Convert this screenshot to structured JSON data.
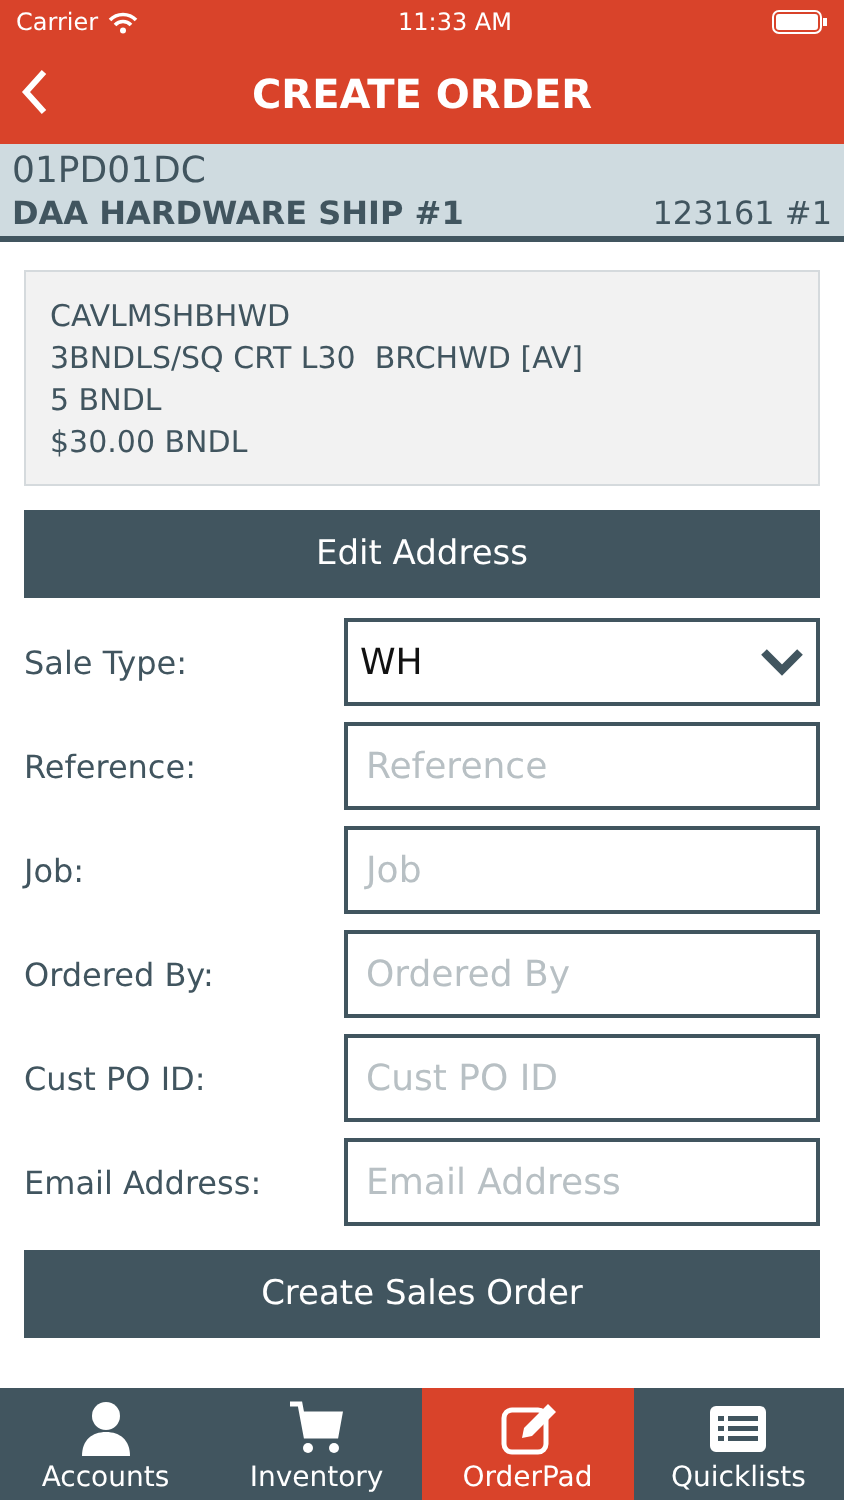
{
  "status_bar": {
    "carrier": "Carrier",
    "time": "11:33 AM"
  },
  "nav": {
    "title": "CREATE ORDER"
  },
  "account": {
    "code": "01PD01DC",
    "name": "DAA HARDWARE SHIP #1",
    "number": "123161 #1"
  },
  "item": {
    "lines": [
      "CAVLMSHBHWD",
      "3BNDLS/SQ CRT L30  BRCHWD [AV]",
      "5 BNDL",
      "$30.00 BNDL"
    ]
  },
  "edit_button": "Edit Address",
  "fields": [
    {
      "label": "Sale Type:",
      "kind": "select",
      "value": "WH"
    },
    {
      "label": "Reference:",
      "kind": "text",
      "placeholder": "Reference"
    },
    {
      "label": "Job:",
      "kind": "text",
      "placeholder": "Job"
    },
    {
      "label": "Ordered By:",
      "kind": "text",
      "placeholder": "Ordered By"
    },
    {
      "label": "Cust PO ID:",
      "kind": "text",
      "placeholder": "Cust PO ID"
    },
    {
      "label": "Email Address:",
      "kind": "text",
      "placeholder": "Email Address"
    }
  ],
  "submit_button": "Create Sales Order",
  "tabs": [
    {
      "label": "Accounts",
      "selected": false
    },
    {
      "label": "Inventory",
      "selected": false
    },
    {
      "label": "OrderPad",
      "selected": true
    },
    {
      "label": "Quicklists",
      "selected": false
    }
  ]
}
